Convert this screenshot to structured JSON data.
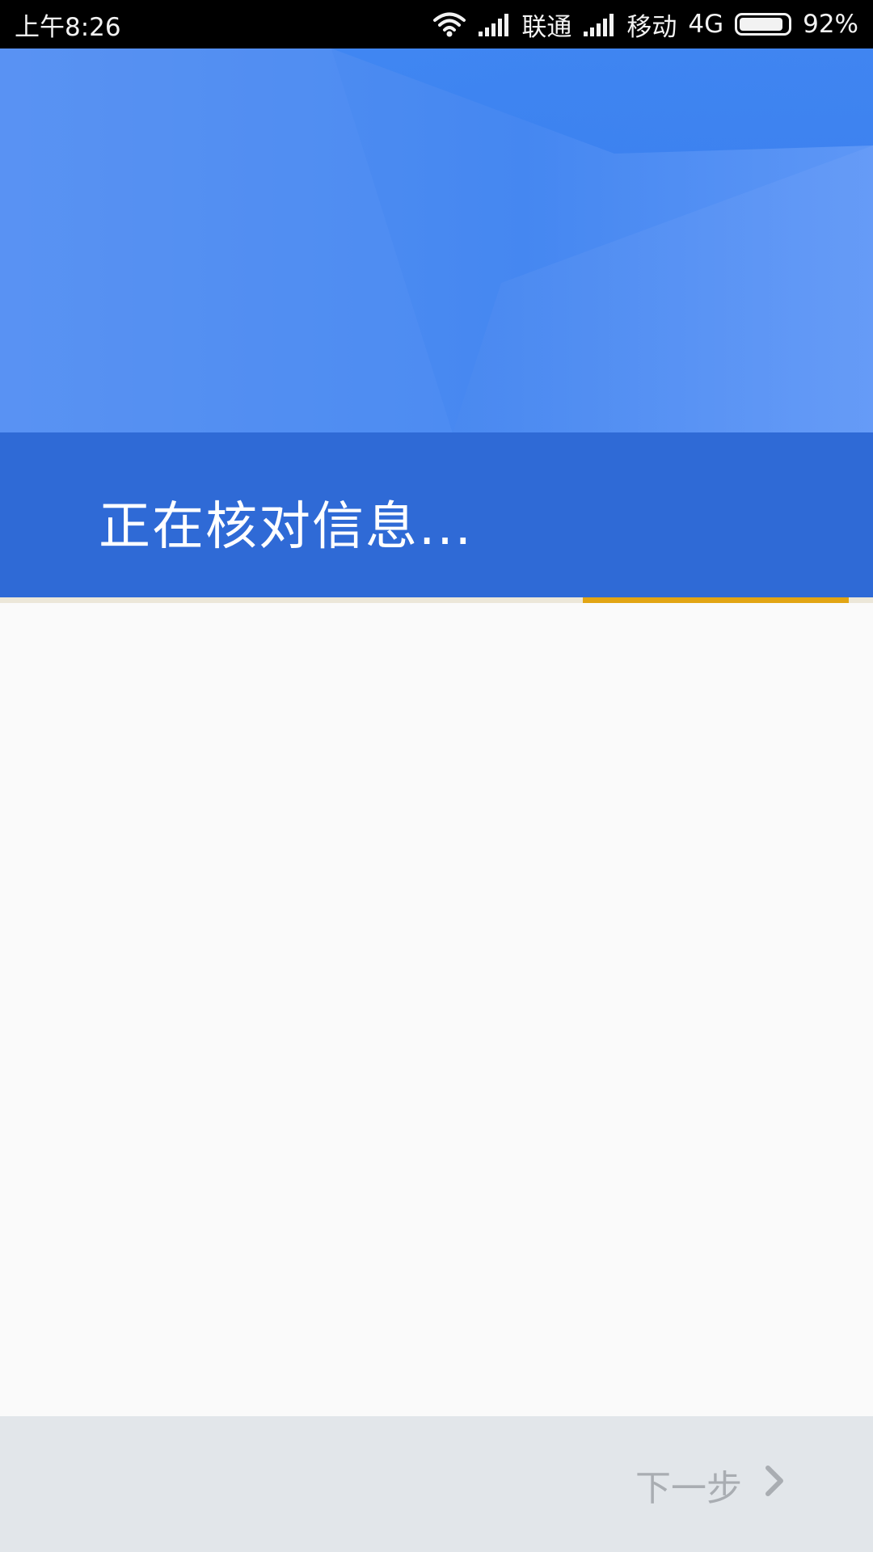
{
  "status_bar": {
    "time": "上午8:26",
    "carrier1": "联通",
    "carrier2": "移动",
    "network": "4G",
    "battery_percent": "92%",
    "battery_level": 0.92,
    "icons": [
      "wifi-icon",
      "signal-icon",
      "signal-icon",
      "battery-icon"
    ]
  },
  "header": {
    "title": "正在核对信息..."
  },
  "progress": {
    "start_fraction": 0.668,
    "end_fraction": 0.972,
    "color": "#e2a514"
  },
  "footer": {
    "next_label": "下一步",
    "next_icon": "chevron-right-icon"
  },
  "colors": {
    "status_bar": "#000000",
    "hero_blue": "#4d8cf1",
    "banner_blue": "#2f6ad6",
    "content_bg": "#fafafa",
    "footer_bg": "#e2e6ea",
    "disabled_text": "#a9adb2"
  }
}
